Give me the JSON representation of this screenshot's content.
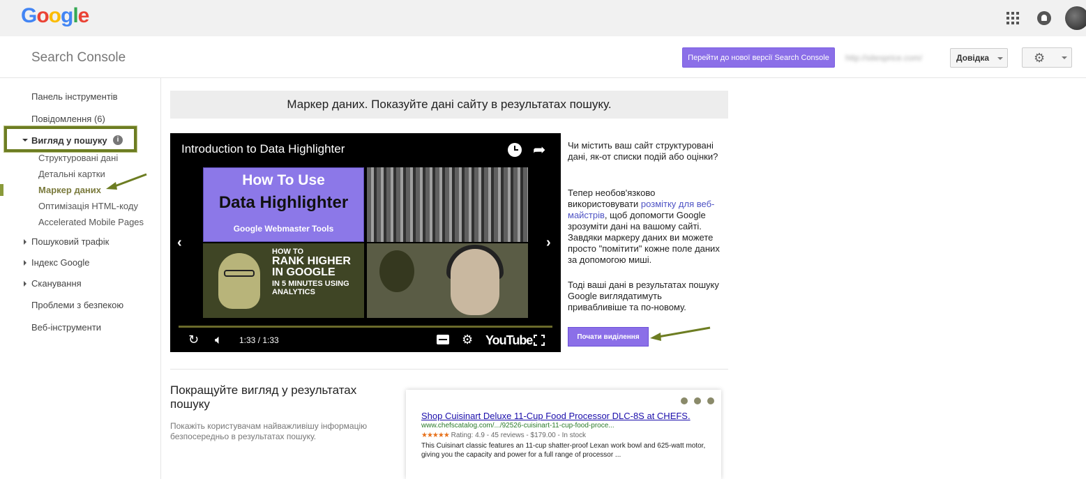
{
  "app": {
    "logo_letters": [
      "G",
      "o",
      "o",
      "g",
      "l",
      "e"
    ],
    "brand": "Search Console"
  },
  "header": {
    "new_version_button": "Перейти до нової версії Search Console",
    "site_url": "http://sitesprice.com/",
    "help_button": "Довідка"
  },
  "sidebar": {
    "dashboard": "Панель інструментів",
    "messages": "Повідомлення (6)",
    "search_appearance": "Вигляд у пошуку",
    "sub_items": [
      "Структуровані дані",
      "Детальні картки",
      "Маркер даних",
      "Оптимізація HTML-коду",
      "Accelerated Mobile Pages"
    ],
    "search_traffic": "Пошуковий трафік",
    "google_index": "Індекс Google",
    "crawl": "Сканування",
    "security_issues": "Проблеми з безпекою",
    "web_tools": "Веб-інструменти"
  },
  "main": {
    "page_title": "Маркер даних. Показуйте дані сайту в результатах пошуку.",
    "video": {
      "title": "Introduction to Data Highlighter",
      "thumb1": [
        "How To Use",
        "Data Highlighter",
        "Google Webmaster Tools"
      ],
      "thumb3": [
        "HOW TO",
        "RANK HIGHER IN GOOGLE",
        "IN 5 MINUTES USING ANALYTICS"
      ],
      "time": "1:33 / 1:33",
      "youtube_label": "YouTube"
    },
    "intro_question": "Чи містить ваш сайт структуровані дані, як-от списки подій або оцінки?",
    "intro_p2_before": "Тепер необов'язково використовувати ",
    "intro_p2_link": "розмітку для веб-майстрів",
    "intro_p2_after": ", щоб допомогти Google зрозуміти дані на вашому сайті. Завдяки маркеру даних ви можете просто \"помітити\" кожне поле даних за допомогою миші.",
    "intro_p3": "Тоді ваші дані в результатах пошуку Google виглядатимуть привабливіше та по-новому.",
    "start_button": "Почати виділення",
    "section2_title": "Покращуйте вигляд у результатах пошуку",
    "section2_desc": "Покажіть користувачам найважливішу інформацію безпосередньо в результатах пошуку.",
    "snippet": {
      "title": "Shop Cuisinart Deluxe 11-Cup Food Processor DLC-8S at CHEFS.",
      "url": "www.chefscatalog.com/.../92526-cuisinart-11-cup-food-proce...",
      "stars": "★★★★★",
      "rating": "Rating: 4.9 - 45 reviews - $179.00 - In stock",
      "description": "This Cuisinart classic features an 11-cup shatter-proof Lexan work bowl and 625-watt motor, giving you the capacity and power for a full range of processor ..."
    }
  },
  "colors": {
    "accent_button": "#8b6fe8",
    "highlight_olive": "#6d7d22",
    "link": "#4d52c4"
  }
}
